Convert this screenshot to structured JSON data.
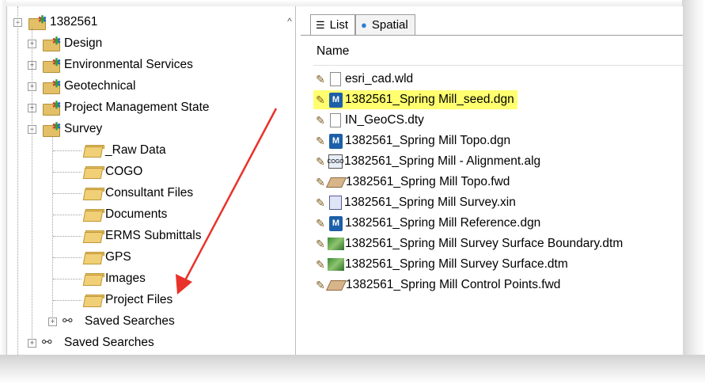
{
  "tree": {
    "root": {
      "label": "1382561",
      "icon": "project-folder-icon",
      "expander": "−"
    },
    "items": [
      {
        "label": "Design",
        "icon": "project-folder-icon",
        "expander": "+"
      },
      {
        "label": "Environmental Services",
        "icon": "project-folder-icon",
        "expander": "+"
      },
      {
        "label": "Geotechnical",
        "icon": "project-folder-icon",
        "expander": "+"
      },
      {
        "label": "Project Management State",
        "icon": "project-folder-icon",
        "expander": "+"
      },
      {
        "label": "Survey",
        "icon": "project-folder-icon",
        "expander": "−"
      }
    ],
    "survey_children": [
      {
        "label": "_Raw Data",
        "icon": "folder-icon"
      },
      {
        "label": "COGO",
        "icon": "folder-icon"
      },
      {
        "label": "Consultant Files",
        "icon": "folder-icon"
      },
      {
        "label": "Documents",
        "icon": "folder-icon"
      },
      {
        "label": "ERMS Submittals",
        "icon": "folder-icon"
      },
      {
        "label": "GPS",
        "icon": "folder-icon"
      },
      {
        "label": "Images",
        "icon": "folder-icon"
      },
      {
        "label": "Project Files",
        "icon": "folder-icon"
      },
      {
        "label": "Saved Searches",
        "icon": "binoculars-icon",
        "expander": "+"
      }
    ],
    "root_saved_searches": {
      "label": "Saved Searches",
      "icon": "binoculars-icon",
      "expander": "+"
    }
  },
  "tabs": [
    {
      "label": "List",
      "icon": "list-icon",
      "active": true
    },
    {
      "label": "Spatial",
      "icon": "globe-icon",
      "active": false
    }
  ],
  "list": {
    "column_header": "Name",
    "files": [
      {
        "name": "esri_cad.wld",
        "icon": "document-icon",
        "highlighted": false
      },
      {
        "name": "1382561_Spring Mill_seed.dgn",
        "icon": "microstation-dgn-icon",
        "highlighted": true
      },
      {
        "name": "IN_GeoCS.dty",
        "icon": "document-icon",
        "highlighted": false
      },
      {
        "name": "1382561_Spring Mill Topo.dgn",
        "icon": "microstation-dgn-icon",
        "highlighted": false
      },
      {
        "name": "1382561_Spring Mill - Alignment.alg",
        "icon": "cogo-alignment-icon",
        "highlighted": false
      },
      {
        "name": "1382561_Spring Mill Topo.fwd",
        "icon": "field-survey-icon",
        "highlighted": false
      },
      {
        "name": "1382561_Spring Mill Survey.xin",
        "icon": "xin-settings-icon",
        "highlighted": false
      },
      {
        "name": "1382561_Spring Mill Reference.dgn",
        "icon": "microstation-dgn-icon",
        "highlighted": false
      },
      {
        "name": "1382561_Spring Mill Survey Surface Boundary.dtm",
        "icon": "terrain-model-icon",
        "highlighted": false
      },
      {
        "name": "1382561_Spring Mill Survey Surface.dtm",
        "icon": "terrain-model-icon",
        "highlighted": false
      },
      {
        "name": "1382561_Spring Mill Control Points.fwd",
        "icon": "field-survey-icon",
        "highlighted": false
      }
    ]
  },
  "colors": {
    "highlight": "#ffff70",
    "annotation_arrow": "#e8322a",
    "dgn_icon": "#1d5fa8"
  },
  "glyphs": {
    "scroll_up": "^",
    "pencil": "✎",
    "dgn_letter": "M",
    "binoculars": "⚯",
    "list_tab_icon": "☰",
    "globe_tab_icon": "●",
    "project_badge": "✱",
    "alg_badge": "COGO"
  }
}
